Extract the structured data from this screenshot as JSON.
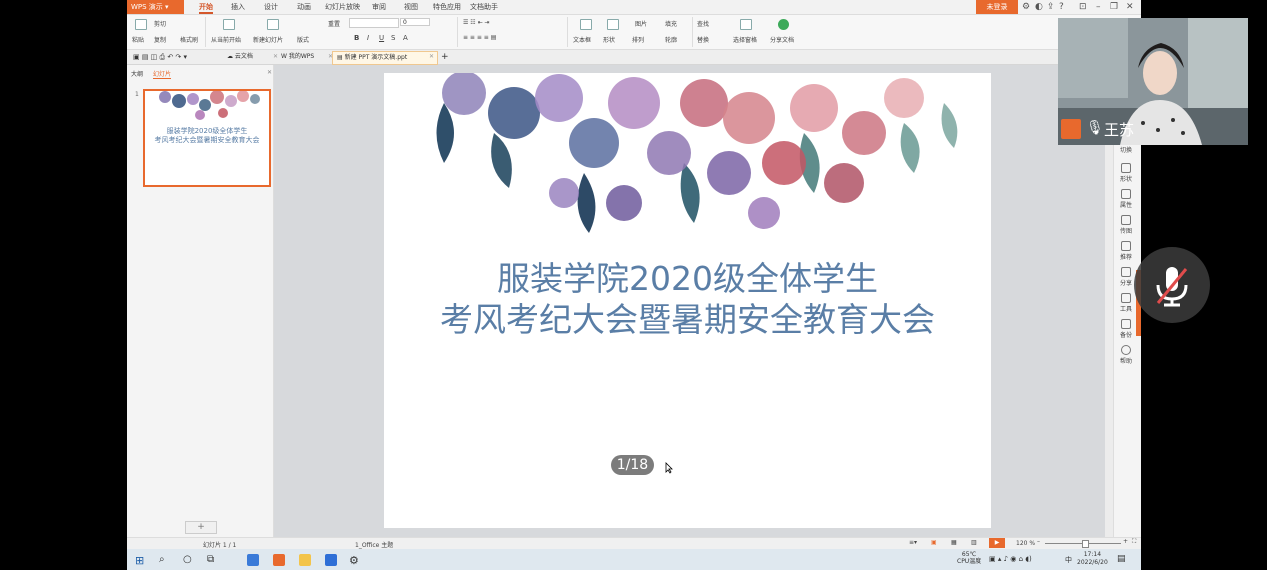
{
  "app": {
    "title": "WPS 演示",
    "login_label": "未登录"
  },
  "menu": [
    "开始",
    "插入",
    "设计",
    "动画",
    "幻灯片放映",
    "审阅",
    "视图",
    "特色应用",
    "文档助手"
  ],
  "ribbon": {
    "paste": "粘贴",
    "cut": "剪切",
    "copy": "复制",
    "format_painter": "格式刷",
    "from_start": "从当前开始",
    "new_slide": "新建幻灯片",
    "layout": "版式",
    "reset": "重置",
    "font_size": "0",
    "text_box": "文本框",
    "shape": "形状",
    "arrange": "排列",
    "picture": "图片",
    "fill": "填充",
    "outline": "轮廓",
    "find": "查找",
    "replace": "替换",
    "select_pane": "选择窗格",
    "share": "分享文档"
  },
  "tabs": [
    {
      "label": "云文档"
    },
    {
      "label": "我的WPS"
    },
    {
      "label": "新建 PPT 演示文稿.ppt"
    }
  ],
  "left_panel": {
    "tab_outline": "大纲",
    "tab_slides": "幻灯片",
    "thumb_number": "1",
    "thumb_line1": "服装学院2020级全体学生",
    "thumb_line2": "考风考纪大会暨暑期安全教育大会",
    "add_label": "+"
  },
  "slide": {
    "line1": "服装学院2020级全体学生",
    "line2": "考风考纪大会暨暑期安全教育大会"
  },
  "page_indicator": "1/18",
  "right_sidebar": [
    "切换",
    "形状",
    "属性",
    "传图",
    "推荐",
    "分享",
    "工具",
    "备份",
    "帮助"
  ],
  "status": {
    "slide_count": "幻灯片 1 / 1",
    "theme": "1_Office 主题",
    "zoom": "120 %"
  },
  "taskbar": {
    "temp": "65℃",
    "cpu": "CPU温度",
    "ime": "中",
    "time": "17:14",
    "date": "2022/6/20"
  },
  "participant": {
    "name": "王苏"
  },
  "colors": {
    "accent": "#e8692d",
    "title_text": "#5a7ea6"
  }
}
